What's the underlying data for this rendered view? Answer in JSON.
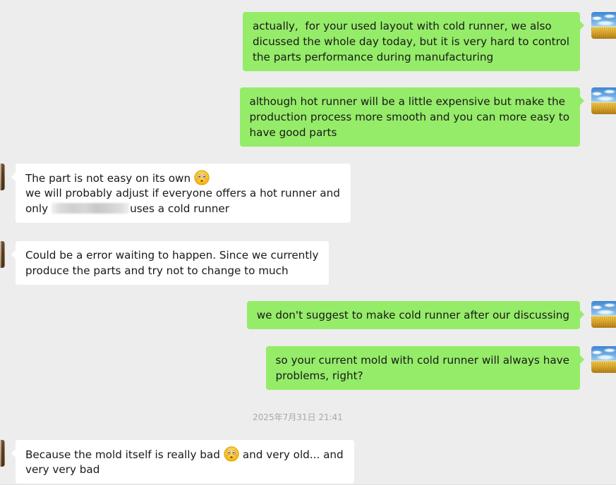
{
  "theme": {
    "background": "#ededed",
    "outgoing_bubble": "#95ec69",
    "incoming_bubble": "#ffffff",
    "message_text": "#191919",
    "timestamp_text": "#a8a8a8"
  },
  "messages": [
    {
      "avatar": "wheat-field-avatar-icon",
      "lines": [
        "actually,  for your used layout with cold runner, we also",
        "dicussed the whole day today, but it is very hard to control",
        "the parts performance during manufacturing"
      ]
    },
    {
      "avatar": "wheat-field-avatar-icon",
      "lines": [
        "although hot runner will be a little expensive but make the",
        "production process more smooth and you can more easy to",
        "have good parts"
      ]
    },
    {
      "avatar": "contact-avatar-icon",
      "lines": [
        {
          "text": "The part is not easy on its own",
          "emoji": "flushed-face-icon"
        },
        {
          "text": "we will probably adjust if everyone offers a hot runner and"
        },
        {
          "before": "only",
          "after": "uses a cold runner"
        }
      ]
    },
    {
      "avatar": "contact-avatar-icon",
      "lines": [
        "Could be a error waiting to happen. Since we currently",
        "produce the parts and try not to change to much"
      ]
    },
    {
      "avatar": "wheat-field-avatar-icon",
      "lines": [
        "we don't suggest to make cold runner after our discussing"
      ]
    },
    {
      "avatar": "wheat-field-avatar-icon",
      "lines": [
        "so your current mold with cold runner will always have",
        "problems, right?"
      ]
    },
    {
      "avatar": "contact-avatar-icon",
      "lines": [
        {
          "before": "Because the mold itself is really bad",
          "emoji": "flushed-face-icon",
          "after": "and very old... and"
        },
        {
          "text": "very very bad"
        }
      ]
    }
  ],
  "time_divider": "2025年7月31日 21:41"
}
